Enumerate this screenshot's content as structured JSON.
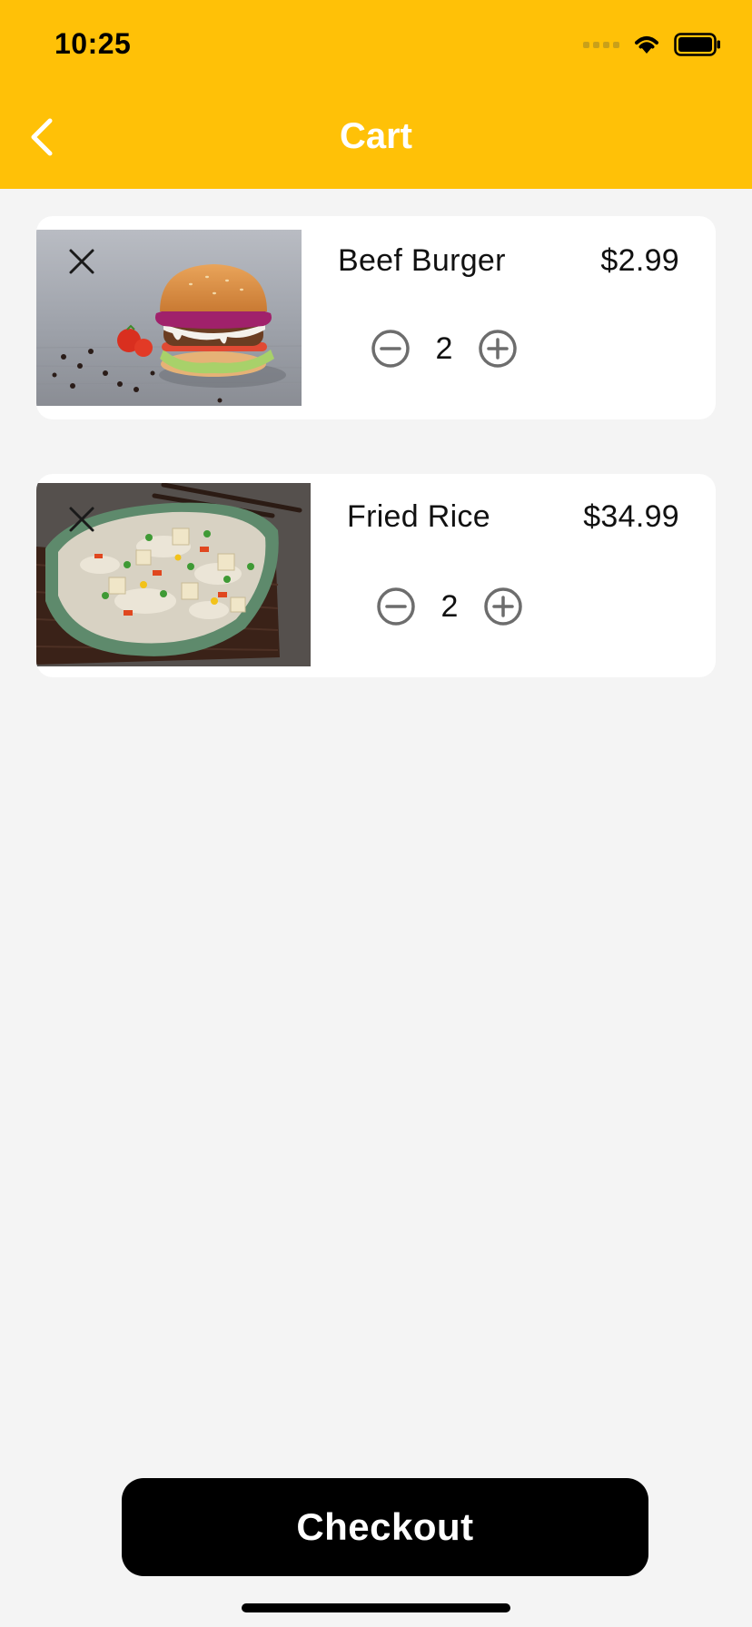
{
  "status_bar": {
    "time": "10:25"
  },
  "header": {
    "title": "Cart",
    "back_icon": "chevron-left-icon"
  },
  "colors": {
    "header_bg": "#FFC107",
    "page_bg": "#f4f4f4",
    "button_bg": "#000000"
  },
  "cart": {
    "items": [
      {
        "name": "Beef Burger",
        "price": "$2.99",
        "quantity": "2",
        "image": "beef-burger-photo"
      },
      {
        "name": "Fried Rice",
        "price": "$34.99",
        "quantity": "2",
        "image": "fried-rice-photo"
      }
    ]
  },
  "checkout": {
    "label": "Checkout"
  }
}
